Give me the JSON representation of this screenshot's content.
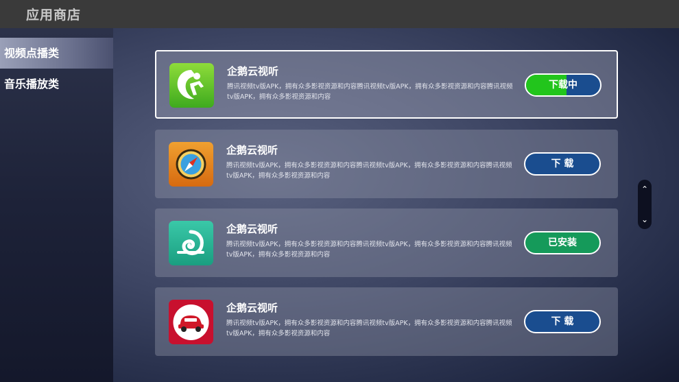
{
  "header": {
    "title": "应用商店"
  },
  "sidebar": {
    "items": [
      {
        "label": "视频点播类",
        "active": true
      },
      {
        "label": "音乐播放类",
        "active": false
      }
    ]
  },
  "apps": [
    {
      "name": "企鹅云视听",
      "description": "腾讯视频tv版APK，拥有众多影视资源和内容腾讯视频tv版APK，拥有众多影视资源和内容腾讯视频tv版APK，拥有众多影视资源和内容",
      "icon": "green-runner-icon",
      "button_label": "下载中",
      "button_state": "downloading",
      "progress": 0.55,
      "focused": true
    },
    {
      "name": "企鹅云视听",
      "description": "腾讯视频tv版APK，拥有众多影视资源和内容腾讯视频tv版APK，拥有众多影视资源和内容腾讯视频tv版APK，拥有众多影视资源和内容",
      "icon": "compass-icon",
      "button_label": "下 载",
      "button_state": "download"
    },
    {
      "name": "企鹅云视听",
      "description": "腾讯视频tv版APK，拥有众多影视资源和内容腾讯视频tv版APK，拥有众多影视资源和内容腾讯视频tv版APK，拥有众多影视资源和内容",
      "icon": "snail-shell-icon",
      "button_label": "已安装",
      "button_state": "installed"
    },
    {
      "name": "企鹅云视听",
      "description": "腾讯视频tv版APK，拥有众多影视资源和内容腾讯视频tv版APK，拥有众多影视资源和内容腾讯视频tv版APK，拥有众多影视资源和内容",
      "icon": "red-car-icon",
      "button_label": "下 载",
      "button_state": "download"
    }
  ],
  "scroll": {
    "up_icon": "chevron-up-icon",
    "down_icon": "chevron-down-icon"
  },
  "colors": {
    "header_bg": "#3a3a3a",
    "download_button": "#1a4d8f",
    "installed_button": "#159a5a",
    "progress_fill": "#22c51c"
  }
}
